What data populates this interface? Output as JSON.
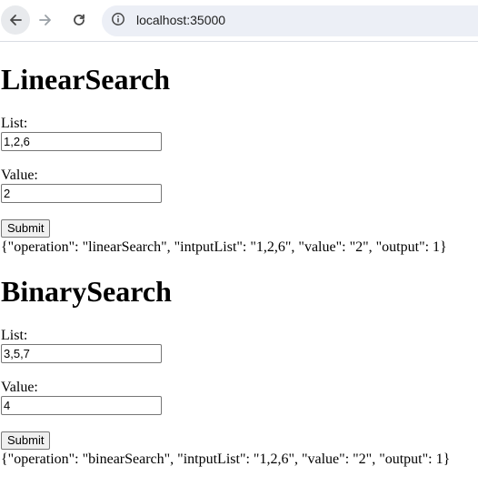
{
  "browser": {
    "url": "localhost:35000"
  },
  "linear_search": {
    "title": "LinearSearch",
    "list_label": "List:",
    "list_value": "1,2,6",
    "value_label": "Value:",
    "value_value": "2",
    "submit_label": "Submit",
    "output": "{\"operation\": \"linearSearch\", \"intputList\": \"1,2,6\", \"value\": \"2\", \"output\": 1}"
  },
  "binary_search": {
    "title": "BinarySearch",
    "list_label": "List:",
    "list_value": "3,5,7",
    "value_label": "Value:",
    "value_value": "4",
    "submit_label": "Submit",
    "output": "{\"operation\": \"binearSearch\", \"intputList\": \"1,2,6\", \"value\": \"2\", \"output\": 1}"
  }
}
